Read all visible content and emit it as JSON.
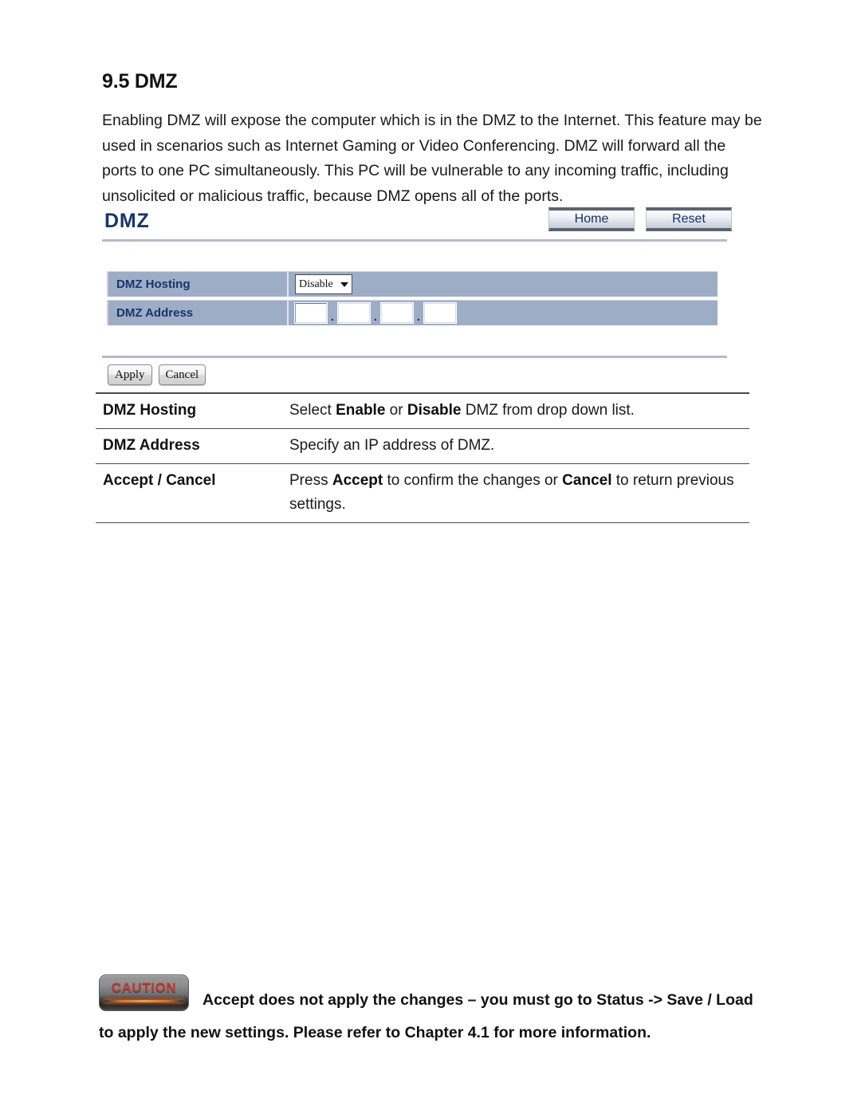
{
  "document": {
    "section_number": "9.5",
    "section_title": "9.5 DMZ",
    "intro_paragraph": "Enabling DMZ will expose the computer which is in the DMZ to the Internet. This feature may be used in scenarios such as Internet Gaming or Video Conferencing. DMZ will forward all the ports to one PC simultaneously. This PC will be vulnerable to any incoming traffic, including unsolicited or malicious traffic, because DMZ opens all of the ports."
  },
  "router_ui": {
    "panel_title": "DMZ",
    "nav_buttons": [
      {
        "label": "Home",
        "name": "home-button"
      },
      {
        "label": "Reset",
        "name": "reset-button"
      }
    ],
    "fields": {
      "dmz_hosting": {
        "label": "DMZ Hosting",
        "control": "dropdown",
        "selected": "Disable",
        "options": [
          "Enable",
          "Disable"
        ]
      },
      "dmz_address": {
        "label": "DMZ Address",
        "control": "ip-quad",
        "octets": [
          "",
          "",
          "",
          ""
        ],
        "separator": "."
      }
    },
    "action_buttons": [
      {
        "label": "Apply",
        "name": "apply-button"
      },
      {
        "label": "Cancel",
        "name": "cancel-button"
      }
    ]
  },
  "description_table": {
    "rows": [
      {
        "term": "DMZ Hosting",
        "definition_parts": [
          {
            "text": "Select ",
            "bold": false
          },
          {
            "text": "Enable",
            "bold": true
          },
          {
            "text": " or ",
            "bold": false
          },
          {
            "text": "Disable",
            "bold": true
          },
          {
            "text": " DMZ from drop down list.",
            "bold": false
          }
        ],
        "definition_plain": "Select Enable or Disable DMZ from drop down list."
      },
      {
        "term": "DMZ Address",
        "definition_parts": [
          {
            "text": "Specify an IP address of DMZ.",
            "bold": false
          }
        ],
        "definition_plain": "Specify an IP address of DMZ."
      },
      {
        "term": "Accept / Cancel",
        "definition_parts": [
          {
            "text": "Press ",
            "bold": false
          },
          {
            "text": "Accept",
            "bold": true
          },
          {
            "text": " to confirm the changes or ",
            "bold": false
          },
          {
            "text": "Cancel",
            "bold": true
          },
          {
            "text": " to return previous settings.",
            "bold": false
          }
        ],
        "definition_plain": "Press Accept to confirm the changes or Cancel to return previous settings."
      }
    ]
  },
  "caution": {
    "badge_label": "CAUTION",
    "note": "Accept does not apply the changes – you must go to Status -> Save / Load to apply the new settings. Please refer to Chapter 4.1 for more information."
  },
  "colors": {
    "panel_title": "#16356b",
    "row_background": "#9dadc6",
    "row_label_text": "#16356b",
    "divider": "#b6b9d0",
    "caution_text": "#c0392b",
    "caution_glow": "#e86a12",
    "button_edge": "#5c6470"
  }
}
